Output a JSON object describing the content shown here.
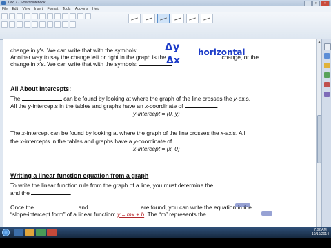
{
  "window": {
    "title": "Doc 7 - Smart Notebook"
  },
  "menu": [
    "File",
    "Edit",
    "View",
    "Insert",
    "Format",
    "Tools",
    "Add-ons",
    "Help"
  ],
  "doc": {
    "l1a": "change in ",
    "l1b": "y",
    "l1c": "'s.  We can write that with the symbols:",
    "l2a": "Another way to say the change left or right in the graph is the",
    "l2b": "change, or the",
    "l3a": "change in ",
    "l3b": "x",
    "l3c": "'s.  We can write that with the symbols:",
    "ink1": "Δy",
    "ink2": "Δx",
    "ink3": "horizontal",
    "h1": "All About Intercepts",
    "h1colon": ":",
    "p1a": "The",
    "p1b": "can be found by looking at where the graph of the line crosses the",
    "p1c": "y",
    "p1d": "-axis.",
    "p2a": "All the ",
    "p2b": "y",
    "p2c": "-intercepts in the tables and graphs have an ",
    "p2d": "x",
    "p2e": "-coordinate of",
    "p2f": ".",
    "f1": "y-intercept = (0, y)",
    "p3a": "The ",
    "p3b": "x",
    "p3c": "-intercept can be found by looking at where the graph of the line crosses the ",
    "p3d": "x",
    "p3e": "-axis.  All",
    "p4a": "the ",
    "p4b": "x",
    "p4c": "-intercepts in the tables and graphs have a ",
    "p4d": "y",
    "p4e": "-coordinate of",
    "p4f": ".",
    "f2": "x-intercept = (x, 0)",
    "h2": "Writing a linear function equation from a graph",
    "p5": "To write the linear function rule from the graph of a line, you must determine the",
    "p6a": "and the",
    "p6b": ".",
    "p7a": "Once the",
    "p7b": "and",
    "p7c": "are found, you can write the equation in the",
    "p8a": "“slope-intercept form” of a linear function:",
    "p8b": "y = mx + b",
    "p8c": ".  The “m” represents the"
  },
  "tray": {
    "time": "7:02 AM",
    "date": "10/10/2014"
  }
}
